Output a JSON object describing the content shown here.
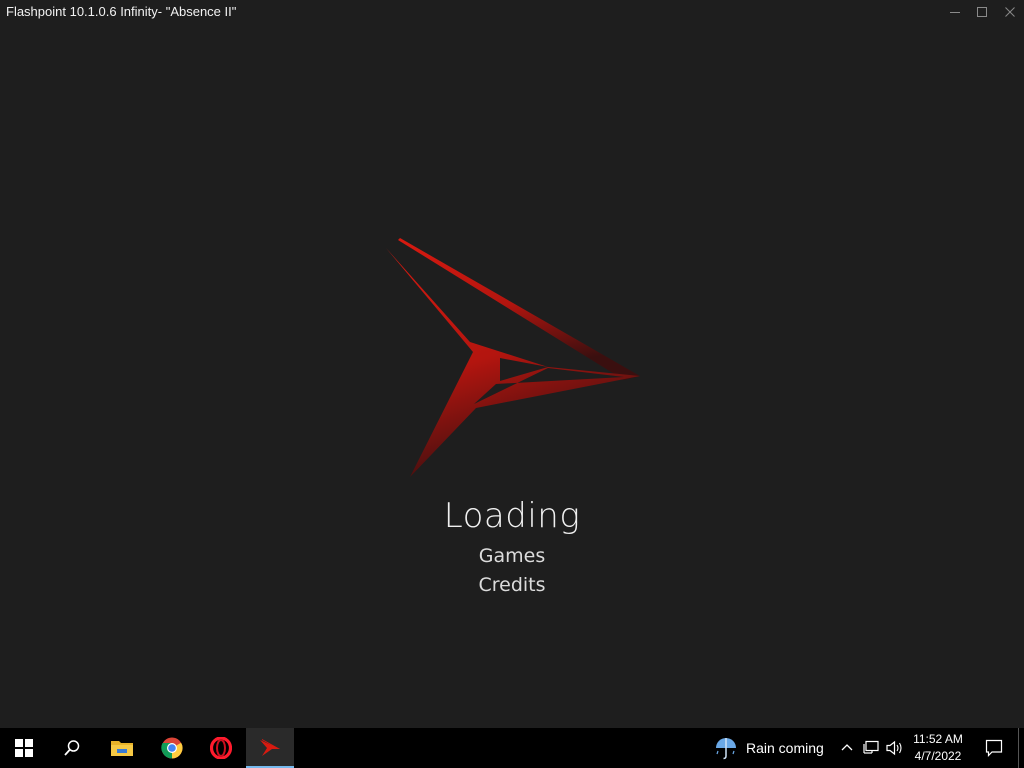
{
  "window": {
    "title": "Flashpoint 10.1.0.6 Infinity- \"Absence II\"",
    "background": "#1e1e1e"
  },
  "splash": {
    "logo_icon": "flashpoint-logo-icon",
    "heading": "Loading",
    "items": [
      "Games",
      "Credits"
    ],
    "accent_color": "#c8160f"
  },
  "taskbar": {
    "apps": [
      {
        "name": "start-button",
        "icon": "windows-logo-icon"
      },
      {
        "name": "search-button",
        "icon": "search-icon"
      },
      {
        "name": "file-explorer",
        "icon": "folder-icon"
      },
      {
        "name": "chrome",
        "icon": "chrome-icon"
      },
      {
        "name": "opera",
        "icon": "opera-icon"
      },
      {
        "name": "flashpoint",
        "icon": "flashpoint-icon",
        "active": true
      }
    ],
    "weather": {
      "icon": "umbrella-rain-icon",
      "text": "Rain coming"
    },
    "tray": {
      "icons": [
        "chevron-up-icon",
        "network-icon",
        "volume-icon"
      ]
    },
    "clock": {
      "time": "11:52 AM",
      "date": "4/7/2022"
    },
    "notifications_icon": "notification-icon"
  }
}
